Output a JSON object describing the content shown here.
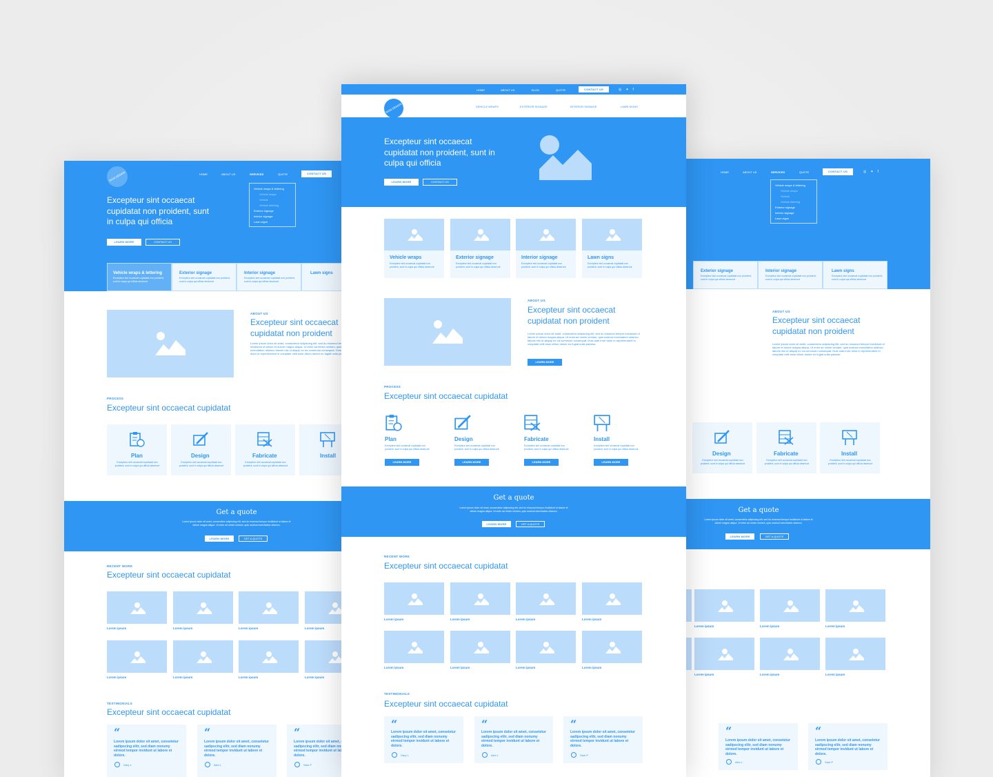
{
  "colors": {
    "accent": "#2f96f3",
    "placeholder": "#bcdcfb",
    "card": "#eef6fe"
  },
  "topbar": {
    "nav": [
      "HOME",
      "ABOUT US",
      "BLOG",
      "QUOTE"
    ],
    "contact": "CONTACT US"
  },
  "backnav": {
    "nav": [
      "HOME",
      "ABOUT US",
      "SERVICES",
      "QUOTE"
    ],
    "contact": "CONTACT US"
  },
  "subnav": [
    "VEHICLE WRAPS",
    "EXTERIOR SIGNAGE",
    "INTERIOR SIGNAGE",
    "LAWN SIGNS"
  ],
  "logo": "SIGN DESIGN",
  "hero": {
    "title": "Excepteur sint occaecat cupidatat non proident, sunt in culpa qui officia",
    "learn": "LEARN MORE",
    "contact": "CONTACT US"
  },
  "dropdown": {
    "items": [
      "Vehicle wraps & lettering",
      "Vehicle wraps",
      "Vehicle",
      "Vehicle lettering",
      "Exterior signage",
      "Interior signage",
      "Lawn signs"
    ]
  },
  "services": [
    {
      "title": "Vehicle wraps",
      "text": "Excepteur sint occaecat cupidatat non proident, sunt in culpa qui officia deserunt"
    },
    {
      "title": "Exterior signage",
      "text": "Excepteur sint occaecat cupidatat non proident, sunt in culpa qui officia deserunt"
    },
    {
      "title": "Interior signage",
      "text": "Excepteur sint occaecat cupidatat non proident, sunt in culpa qui officia deserunt"
    },
    {
      "title": "Lawn signs",
      "text": "Excepteur sint occaecat cupidatat non proident, sunt in culpa qui officia deserunt"
    }
  ],
  "tabs": [
    "Vehicle wraps & lettering",
    "Exterior signage",
    "Interior signage",
    "Lawn signs"
  ],
  "tabtext": "Excepteur sint occaecat cupidatat non proident, sunt in culpa qui officia deserunt",
  "about": {
    "label": "ABOUT US",
    "title": "Excepteur sint occaecat cupidatat non proident",
    "body": "Lorem ipsum dolor sit amet, consectetur adipiscing elit, sed do eiusmod tempor incididunt ut labore et dolore magna aliqua. Ut enim ad minim veniam, quis nostrud exercitation ullamco laboris nisi ut aliquip ex ea commodo consequat. Duis aute irure dolor in reprehenderit in voluptate velit esse cillum dolore eu fugiat nulla pariatur.",
    "button": "LEARN MORE"
  },
  "process": {
    "label": "PROCESS",
    "title": "Excepteur sint occaecat cupidatat",
    "steps": [
      {
        "title": "Plan",
        "text": "Excepteur sint occaecat cupidatat non proident, sunt in culpa qui officia deserunt",
        "button": "LEARN MORE"
      },
      {
        "title": "Design",
        "text": "Excepteur sint occaecat cupidatat non proident, sunt in culpa qui officia deserunt",
        "button": "LEARN MORE"
      },
      {
        "title": "Fabricate",
        "text": "Excepteur sint occaecat cupidatat non proident, sunt in culpa qui officia deserunt",
        "button": "LEARN MORE"
      },
      {
        "title": "Install",
        "text": "Excepteur sint occaecat cupidatat non proident, sunt in culpa qui officia deserunt",
        "button": "LEARN MORE"
      }
    ]
  },
  "quote": {
    "title": "Get a quote",
    "text": "Lorem ipsum dolor sit amet, consectetur adipiscing elit, sed do eiusmod tempor incididunt ut labore et dolore magna aliqua. Ut enim ad minim veniam, quis nostrud exercitation ullamco.",
    "btn1": "LEARN MORE",
    "btn2": "GET A QUOTE"
  },
  "recent": {
    "label": "RECENT WORK",
    "title": "Excepteur sint occaecat cupidatat",
    "caption": "Lorem ipsum"
  },
  "testimonials": {
    "label": "TESTIMONIALS",
    "title": "Excepteur sint occaecat cupidatat",
    "items": [
      {
        "text": "Lorem ipsum dolor sit amet, consetetur sadipscing elitr, sed diam nonumy eirmod tempor invidunt ut labore et dolore.",
        "name": "Gary L"
      },
      {
        "text": "Lorem ipsum dolor sit amet, consetetur sadipscing elitr, sed diam nonumy eirmod tempor invidunt ut labore et dolore.",
        "name": "Alex L"
      },
      {
        "text": "Lorem ipsum dolor sit amet, consetetur sadipscing elitr, sed diam nonumy eirmod tempor invidunt ut labore et dolore.",
        "name": "Sam P"
      }
    ]
  }
}
